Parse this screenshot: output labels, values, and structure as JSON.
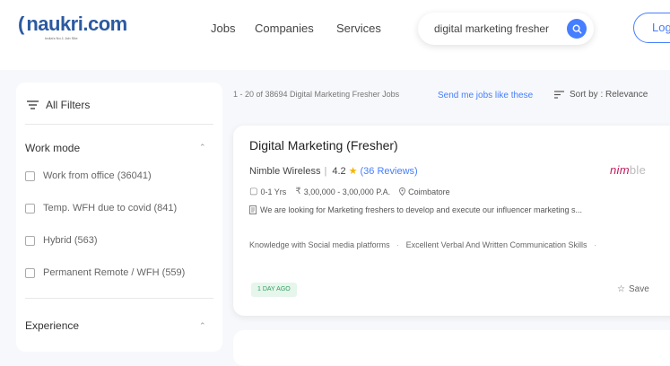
{
  "header": {
    "logo_icon": "(",
    "logo_text": "naukri.com",
    "logo_tagline": "India's No.1 Job Site",
    "nav": [
      "Jobs",
      "Companies",
      "Services"
    ],
    "search_value": "digital marketing fresher",
    "login_label": "Login"
  },
  "filters": {
    "all_filters_label": "All Filters",
    "work_mode": {
      "title": "Work mode",
      "options": [
        "Work from office (36041)",
        "Temp. WFH due to covid (841)",
        "Hybrid (563)",
        "Permanent Remote / WFH (559)"
      ]
    },
    "experience": {
      "title": "Experience"
    }
  },
  "results": {
    "count_text": "1 - 20 of 38694 Digital Marketing Fresher Jobs",
    "send_link": "Send me jobs like these",
    "sort_label": "Sort by : Relevance"
  },
  "job": {
    "title": "Digital Marketing (Fresher)",
    "company": "Nimble Wireless",
    "rating": "4.2",
    "reviews": "(36 Reviews)",
    "company_logo_main": "nim",
    "company_logo_rest": "ble",
    "experience": "0-1 Yrs",
    "salary": "3,00,000 - 3,00,000 P.A.",
    "location": "Coimbatore",
    "description": "We are looking for Marketing freshers to develop and execute our influencer marketing s...",
    "tags": [
      "Knowledge with Social media platforms",
      "Excellent Verbal And Written Communication Skills"
    ],
    "posted": "1 DAY AGO",
    "save_label": "Save"
  },
  "colors": {
    "brand_blue": "#457eff",
    "logo_blue": "#2c5aa0",
    "star": "#f5b400",
    "badge_green": "#2f9e5e",
    "company_logo_red": "#c2185b"
  }
}
